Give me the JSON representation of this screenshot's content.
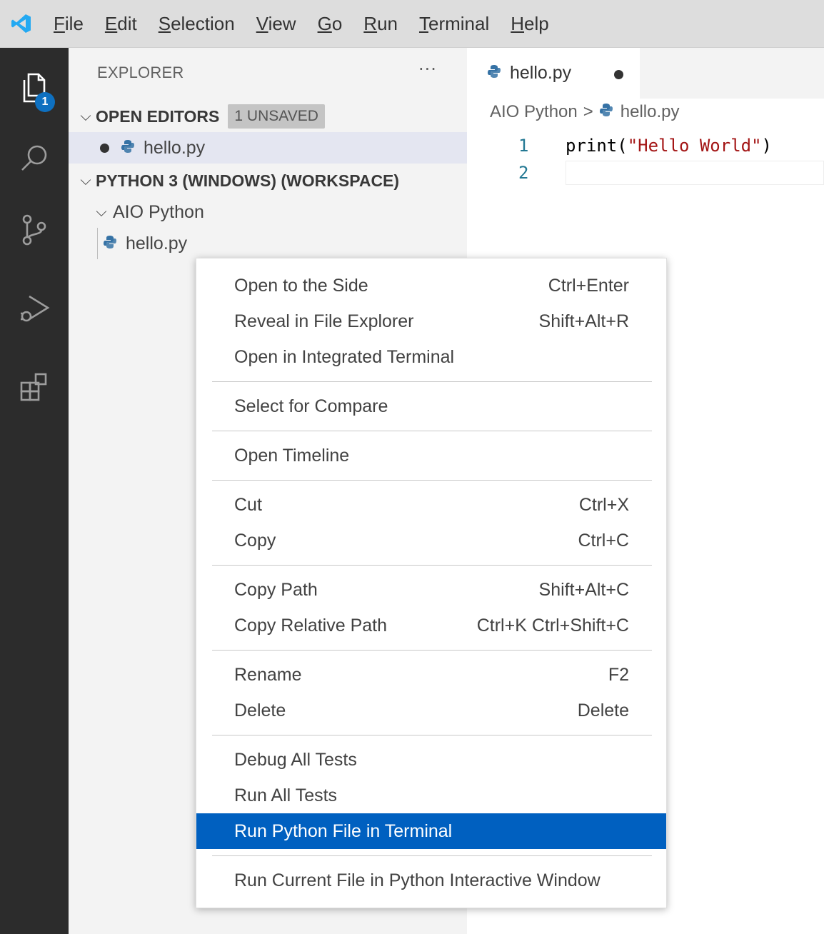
{
  "menubar": {
    "items": [
      {
        "mnemonic": "F",
        "rest": "ile"
      },
      {
        "mnemonic": "E",
        "rest": "dit"
      },
      {
        "mnemonic": "S",
        "rest": "election"
      },
      {
        "mnemonic": "V",
        "rest": "iew"
      },
      {
        "mnemonic": "G",
        "rest": "o"
      },
      {
        "mnemonic": "R",
        "rest": "un"
      },
      {
        "mnemonic": "T",
        "rest": "erminal"
      },
      {
        "mnemonic": "H",
        "rest": "elp"
      }
    ]
  },
  "activity_bar": {
    "explorer_badge": "1",
    "icons": [
      "explorer-icon",
      "search-icon",
      "source-control-icon",
      "run-debug-icon",
      "extensions-icon"
    ]
  },
  "sidebar": {
    "title": "EXPLORER",
    "more": "···",
    "open_editors": {
      "label": "OPEN EDITORS",
      "badge": "1 UNSAVED",
      "file": "hello.py"
    },
    "workspace": {
      "label": "PYTHON 3 (WINDOWS) (WORKSPACE)",
      "folder": "AIO Python",
      "file": "hello.py"
    }
  },
  "editor": {
    "tab_label": "hello.py",
    "breadcrumb": {
      "folder": "AIO Python",
      "separator": ">",
      "file": "hello.py"
    },
    "lines": [
      {
        "number": "1",
        "code_fn": "print(",
        "code_str": "\"Hello World\"",
        "code_end": ")"
      },
      {
        "number": "2",
        "code_fn": "",
        "code_str": "",
        "code_end": ""
      }
    ]
  },
  "context_menu": {
    "groups": [
      [
        {
          "label": "Open to the Side",
          "shortcut": "Ctrl+Enter"
        },
        {
          "label": "Reveal in File Explorer",
          "shortcut": "Shift+Alt+R"
        },
        {
          "label": "Open in Integrated Terminal",
          "shortcut": ""
        }
      ],
      [
        {
          "label": "Select for Compare",
          "shortcut": ""
        }
      ],
      [
        {
          "label": "Open Timeline",
          "shortcut": ""
        }
      ],
      [
        {
          "label": "Cut",
          "shortcut": "Ctrl+X"
        },
        {
          "label": "Copy",
          "shortcut": "Ctrl+C"
        }
      ],
      [
        {
          "label": "Copy Path",
          "shortcut": "Shift+Alt+C"
        },
        {
          "label": "Copy Relative Path",
          "shortcut": "Ctrl+K Ctrl+Shift+C"
        }
      ],
      [
        {
          "label": "Rename",
          "shortcut": "F2"
        },
        {
          "label": "Delete",
          "shortcut": "Delete"
        }
      ],
      [
        {
          "label": "Debug All Tests",
          "shortcut": ""
        },
        {
          "label": "Run All Tests",
          "shortcut": ""
        },
        {
          "label": "Run Python File in Terminal",
          "shortcut": "",
          "highlighted": true
        }
      ],
      [
        {
          "label": "Run Current File in Python Interactive Window",
          "shortcut": ""
        }
      ]
    ]
  },
  "colors": {
    "activity_bar": "#2c2c2c",
    "sidebar": "#f3f3f3",
    "menu_highlight": "#0060c0",
    "badge": "#0e70c0",
    "vscode_blue": "#23a9f2",
    "python_blue": "#3572a5",
    "python_yellow": "#ffd43b"
  }
}
